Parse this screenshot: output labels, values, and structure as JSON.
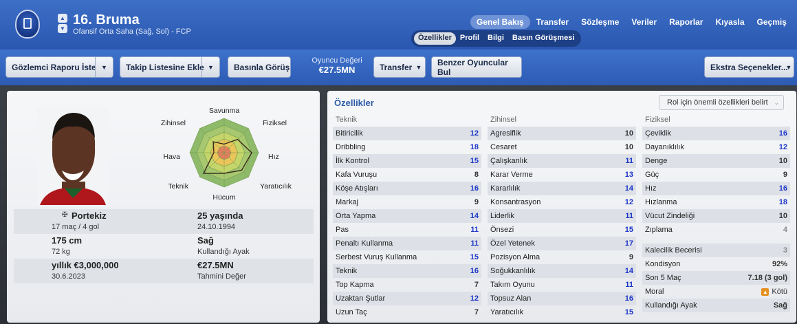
{
  "header": {
    "player_name": "16. Bruma",
    "player_position": "Ofansif Orta Saha (Sağ, Sol) - FCP",
    "main_tabs": [
      "Genel Bakış",
      "Transfer",
      "Sözleşme",
      "Veriler",
      "Raporlar",
      "Kıyasla",
      "Geçmiş"
    ],
    "sub_tabs": [
      "Özellikler",
      "Profil",
      "Bilgi",
      "Basın Görüşmesi"
    ]
  },
  "toolbar": {
    "scout_report": "Gözlemci Raporu İste",
    "shortlist": "Takip Listesine Ekle",
    "press": "Basınla Görüş",
    "value_label": "Oyuncu Değeri",
    "value_amount": "€27.5MN",
    "transfer": "Transfer",
    "similar": "Benzer Oyuncular Bul",
    "extra": "Ekstra Seçenekler..."
  },
  "radar": {
    "labels": [
      "Savunma",
      "Fiziksel",
      "Hız",
      "Yaratıcılık",
      "Hücum",
      "Teknik",
      "Hava",
      "Zihinsel"
    ]
  },
  "profile": {
    "nation": "Portekiz",
    "caps": "17 maç / 4 gol",
    "age": "25 yaşında",
    "dob": "24.10.1994",
    "height": "175 cm",
    "weight": "72 kg",
    "foot": "Sağ",
    "foot_label": "Kullandığı Ayak",
    "wage": "yıllık €3,000,000",
    "contract_end": "30.6.2023",
    "est_value": "€27.5MN",
    "est_value_label": "Tahmini Değer"
  },
  "attributes": {
    "title": "Özellikler",
    "role_button": "Rol için önemli özellikleri belirt",
    "technical_header": "Teknik",
    "mental_header": "Zihinsel",
    "physical_header": "Fiziksel",
    "technical": [
      {
        "name": "Bitiricilik",
        "value": "12"
      },
      {
        "name": "Dribbling",
        "value": "18"
      },
      {
        "name": "İlk Kontrol",
        "value": "15"
      },
      {
        "name": "Kafa Vuruşu",
        "value": "8"
      },
      {
        "name": "Köşe Atışları",
        "value": "16"
      },
      {
        "name": "Markaj",
        "value": "9"
      },
      {
        "name": "Orta Yapma",
        "value": "14"
      },
      {
        "name": "Pas",
        "value": "11"
      },
      {
        "name": "Penaltı Kullanma",
        "value": "11"
      },
      {
        "name": "Serbest Vuruş Kullanma",
        "value": "15"
      },
      {
        "name": "Teknik",
        "value": "16"
      },
      {
        "name": "Top Kapma",
        "value": "7"
      },
      {
        "name": "Uzaktan Şutlar",
        "value": "12"
      },
      {
        "name": "Uzun Taç",
        "value": "7"
      }
    ],
    "mental": [
      {
        "name": "Agresiflik",
        "value": "10"
      },
      {
        "name": "Cesaret",
        "value": "10"
      },
      {
        "name": "Çalışkanlık",
        "value": "11"
      },
      {
        "name": "Karar Verme",
        "value": "13"
      },
      {
        "name": "Kararlılık",
        "value": "14"
      },
      {
        "name": "Konsantrasyon",
        "value": "12"
      },
      {
        "name": "Liderlik",
        "value": "11"
      },
      {
        "name": "Önsezi",
        "value": "15"
      },
      {
        "name": "Özel Yetenek",
        "value": "17"
      },
      {
        "name": "Pozisyon Alma",
        "value": "9"
      },
      {
        "name": "Soğukkanlılık",
        "value": "14"
      },
      {
        "name": "Takım Oyunu",
        "value": "11"
      },
      {
        "name": "Topsuz Alan",
        "value": "16"
      },
      {
        "name": "Yaratıcılık",
        "value": "15"
      }
    ],
    "physical": [
      {
        "name": "Çeviklik",
        "value": "16"
      },
      {
        "name": "Dayanıklılık",
        "value": "12"
      },
      {
        "name": "Denge",
        "value": "10"
      },
      {
        "name": "Güç",
        "value": "9"
      },
      {
        "name": "Hız",
        "value": "16"
      },
      {
        "name": "Hızlanma",
        "value": "18"
      },
      {
        "name": "Vücut Zindeliği",
        "value": "10"
      },
      {
        "name": "Zıplama",
        "value": "4"
      }
    ],
    "extra": [
      {
        "name": "Kalecilik Becerisi",
        "value": "3"
      },
      {
        "name": "Kondisyon",
        "value": "92%"
      },
      {
        "name": "Son 5 Maç",
        "value": "7.18 (3 gol)"
      },
      {
        "name": "Moral",
        "value": "Kötü"
      },
      {
        "name": "Kullandığı Ayak",
        "value": "Sağ"
      }
    ]
  },
  "colors": {
    "accent_blue": "#2a57b0",
    "high_value": "#1c35c9",
    "morale_badge": "#e6901f"
  }
}
